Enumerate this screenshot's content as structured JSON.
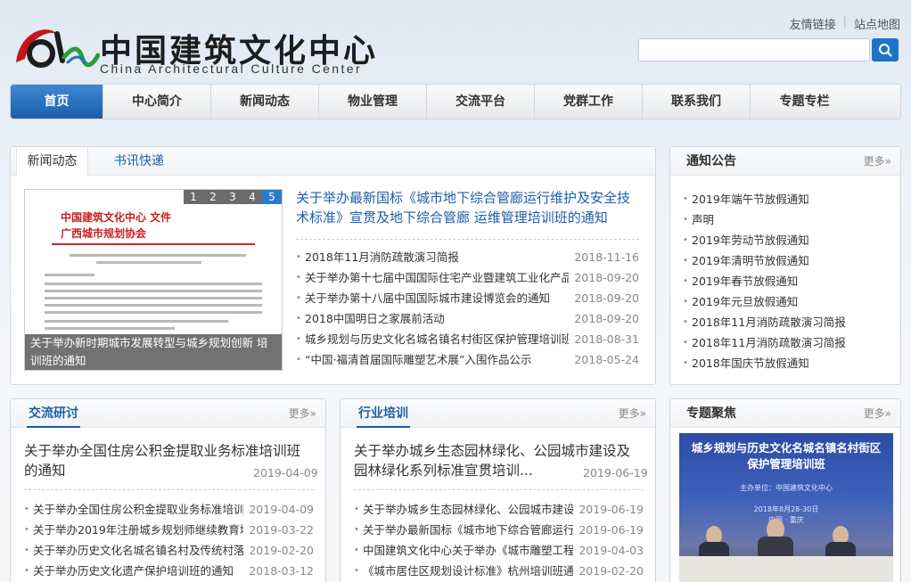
{
  "header": {
    "logo_cn": "中国建筑文化中心",
    "logo_en": "China Architectural Culture Center",
    "links": [
      "友情链接",
      "站点地图"
    ],
    "search_value": ""
  },
  "nav": {
    "items": [
      "首页",
      "中心简介",
      "新闻动态",
      "物业管理",
      "交流平台",
      "党群工作",
      "联系我们",
      "专题专栏"
    ]
  },
  "news": {
    "tabs": [
      "新闻动态",
      "书讯快递"
    ],
    "pager": [
      "1",
      "2",
      "3",
      "4",
      "5"
    ],
    "doc_header1": "中国建筑文化中心 文件",
    "doc_header2": "广西城市规划协会",
    "image_caption": "关于举办新时期城市发展转型与城乡规划创新 培训班的通知",
    "headline": "关于举办最新国标《城市地下综合管廊运行维护及安全技术标准》宣贯及地下综合管廊 运维管理培训班的通知",
    "items": [
      {
        "title": "2018年11月消防疏散演习简报",
        "date": "2018-11-16"
      },
      {
        "title": "关于举办第十七届中国国际住宅产业暨建筑工业化产品",
        "date": "2018-09-20"
      },
      {
        "title": "关于举办第十八届中国国际城市建设博览会的通知",
        "date": "2018-09-20"
      },
      {
        "title": "2018中国明日之家展前活动",
        "date": "2018-09-20"
      },
      {
        "title": "城乡规划与历史文化名城名镇名村街区保护管理培训班",
        "date": "2018-08-31"
      },
      {
        "title": "“中国·福清首届国际雕塑艺术展”入围作品公示",
        "date": "2018-05-24"
      }
    ]
  },
  "notice": {
    "title": "通知公告",
    "more": "更多»",
    "items": [
      "2019年端午节放假通知",
      "声明",
      "2019年劳动节放假通知",
      "2019年清明节放假通知",
      "2019年春节放假通知",
      "2019年元旦放假通知",
      "2018年11月消防疏散演习简报",
      "2018年11月消防疏散演习简报",
      "2018年国庆节放假通知"
    ]
  },
  "exchange": {
    "title": "交流研讨",
    "more": "更多»",
    "feature_title": "关于举办全国住房公积金提取业务标准培训班的通知",
    "feature_date": "2019-04-09",
    "items": [
      {
        "title": "关于举办全国住房公积金提取业务标准培训班",
        "date": "2019-04-09"
      },
      {
        "title": "关于举办2019年注册城乡规划师继续教育培训",
        "date": "2019-03-22"
      },
      {
        "title": "关于举办历史文化名城名镇名村及传统村落",
        "date": "2019-02-20"
      },
      {
        "title": "关于举办历史文化遗产保护培训班的通知",
        "date": "2018-03-12"
      }
    ]
  },
  "training": {
    "title": "行业培训",
    "more": "更多»",
    "feature_title": "关于举办城乡生态园林绿化、公园城市建设及园林绿化系列标准宣贯培训...",
    "feature_date": "2019-06-19",
    "items": [
      {
        "title": "关于举办城乡生态园林绿化、公园城市建设及",
        "date": "2019-06-19"
      },
      {
        "title": "关于举办最新国标《城市地下综合管廊运行维",
        "date": "2019-06-19"
      },
      {
        "title": "中国建筑文化中心关于举办《城市雕塑工程技",
        "date": "2019-04-03"
      },
      {
        "title": "《城市居住区规划设计标准》杭州培训班通知",
        "date": "2019-02-20"
      }
    ]
  },
  "topic": {
    "title": "专题聚焦",
    "more": "更多»",
    "image_title": "城乡规划与历史文化名城名镇名村街区保护管理培训班",
    "image_sub1": "主办单位：中国建筑文化中心",
    "image_sub2": "2018年8月28-30日",
    "image_sub3": "中国 · 重庆"
  },
  "colors": {
    "primary": "#1b5fa8",
    "accent": "#2a7bd1",
    "logo_red": "#c4161c"
  }
}
